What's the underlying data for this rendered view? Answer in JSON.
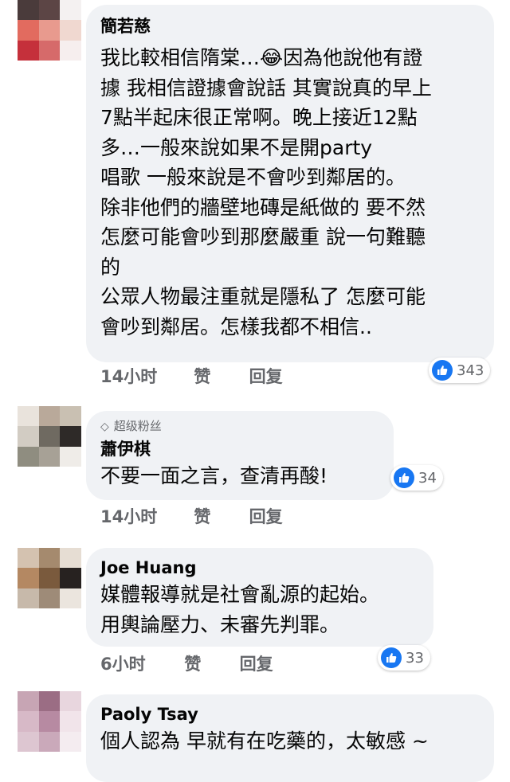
{
  "colors": {
    "bubble_bg": "#f0f2f5",
    "meta_text": "#65676b",
    "like_blue": "#1877f2"
  },
  "comments": [
    {
      "author": "簡若慈",
      "badge": "",
      "lines": [
        "我比較相信隋棠…😂因為他說他有證",
        "據 我相信證據會說話 其實說真的早上",
        "7點半起床很正常啊。晚上接近12點",
        "多…一般來說如果不是開party",
        "唱歌 一般來說是不會吵到鄰居的。",
        "除非他們的牆壁地磚是紙做的 要不然",
        "怎麼可能會吵到那麼嚴重  說一句難聽",
        "的",
        "公眾人物最注重就是隱私了 怎麼可能",
        "會吵到鄰居。怎樣我都不相信.."
      ],
      "time": "14小时",
      "like": "赞",
      "reply": "回复",
      "reaction_count": "343",
      "reaction_icon": "like-icon",
      "avatar_colors": [
        "#4a3b3b",
        "#5c4545",
        "#f4f1f1",
        "#e26b5f",
        "#e89a8e",
        "#f0d8d0",
        "#c5303b",
        "#d66a6a",
        "#f6eeee"
      ]
    },
    {
      "author": "蕭伊棋",
      "badge": "超级粉丝",
      "badge_icon": "diamond-icon",
      "lines": [
        "不要一面之言，查清再酸!"
      ],
      "time": "14小时",
      "like": "赞",
      "reply": "回复",
      "reaction_count": "34",
      "reaction_icon": "like-icon",
      "avatar_colors": [
        "#e9e3dc",
        "#b9a99a",
        "#c9c0b2",
        "#d2ccc3",
        "#6f6a61",
        "#2e2a28",
        "#8f8d80",
        "#a7a196",
        "#efece8"
      ]
    },
    {
      "author": "Joe Huang",
      "badge": "",
      "lines": [
        "媒體報導就是社會亂源的起始。",
        "用輿論壓力、未審先判罪。"
      ],
      "time": "6小时",
      "like": "赞",
      "reply": "回复",
      "reaction_count": "33",
      "reaction_icon": "like-icon",
      "avatar_colors": [
        "#d4c2b0",
        "#a58a6e",
        "#e6ddd3",
        "#b48862",
        "#7a5a3d",
        "#272220",
        "#c7b9aa",
        "#9e8b78",
        "#ebe5de"
      ]
    },
    {
      "author": "Paoly Tsay",
      "badge": "",
      "lines": [
        "個人認為  早就有在吃藥的，太敏感 ~"
      ],
      "time": "",
      "like": "",
      "reply": "",
      "reaction_count": "",
      "avatar_colors": [
        "#c7a5b4",
        "#9b6d84",
        "#e8d6de",
        "#d7b9c7",
        "#b78aa2",
        "#f1e4ea",
        "#ddc6d1",
        "#caa9ba",
        "#f4ecf0"
      ]
    }
  ]
}
